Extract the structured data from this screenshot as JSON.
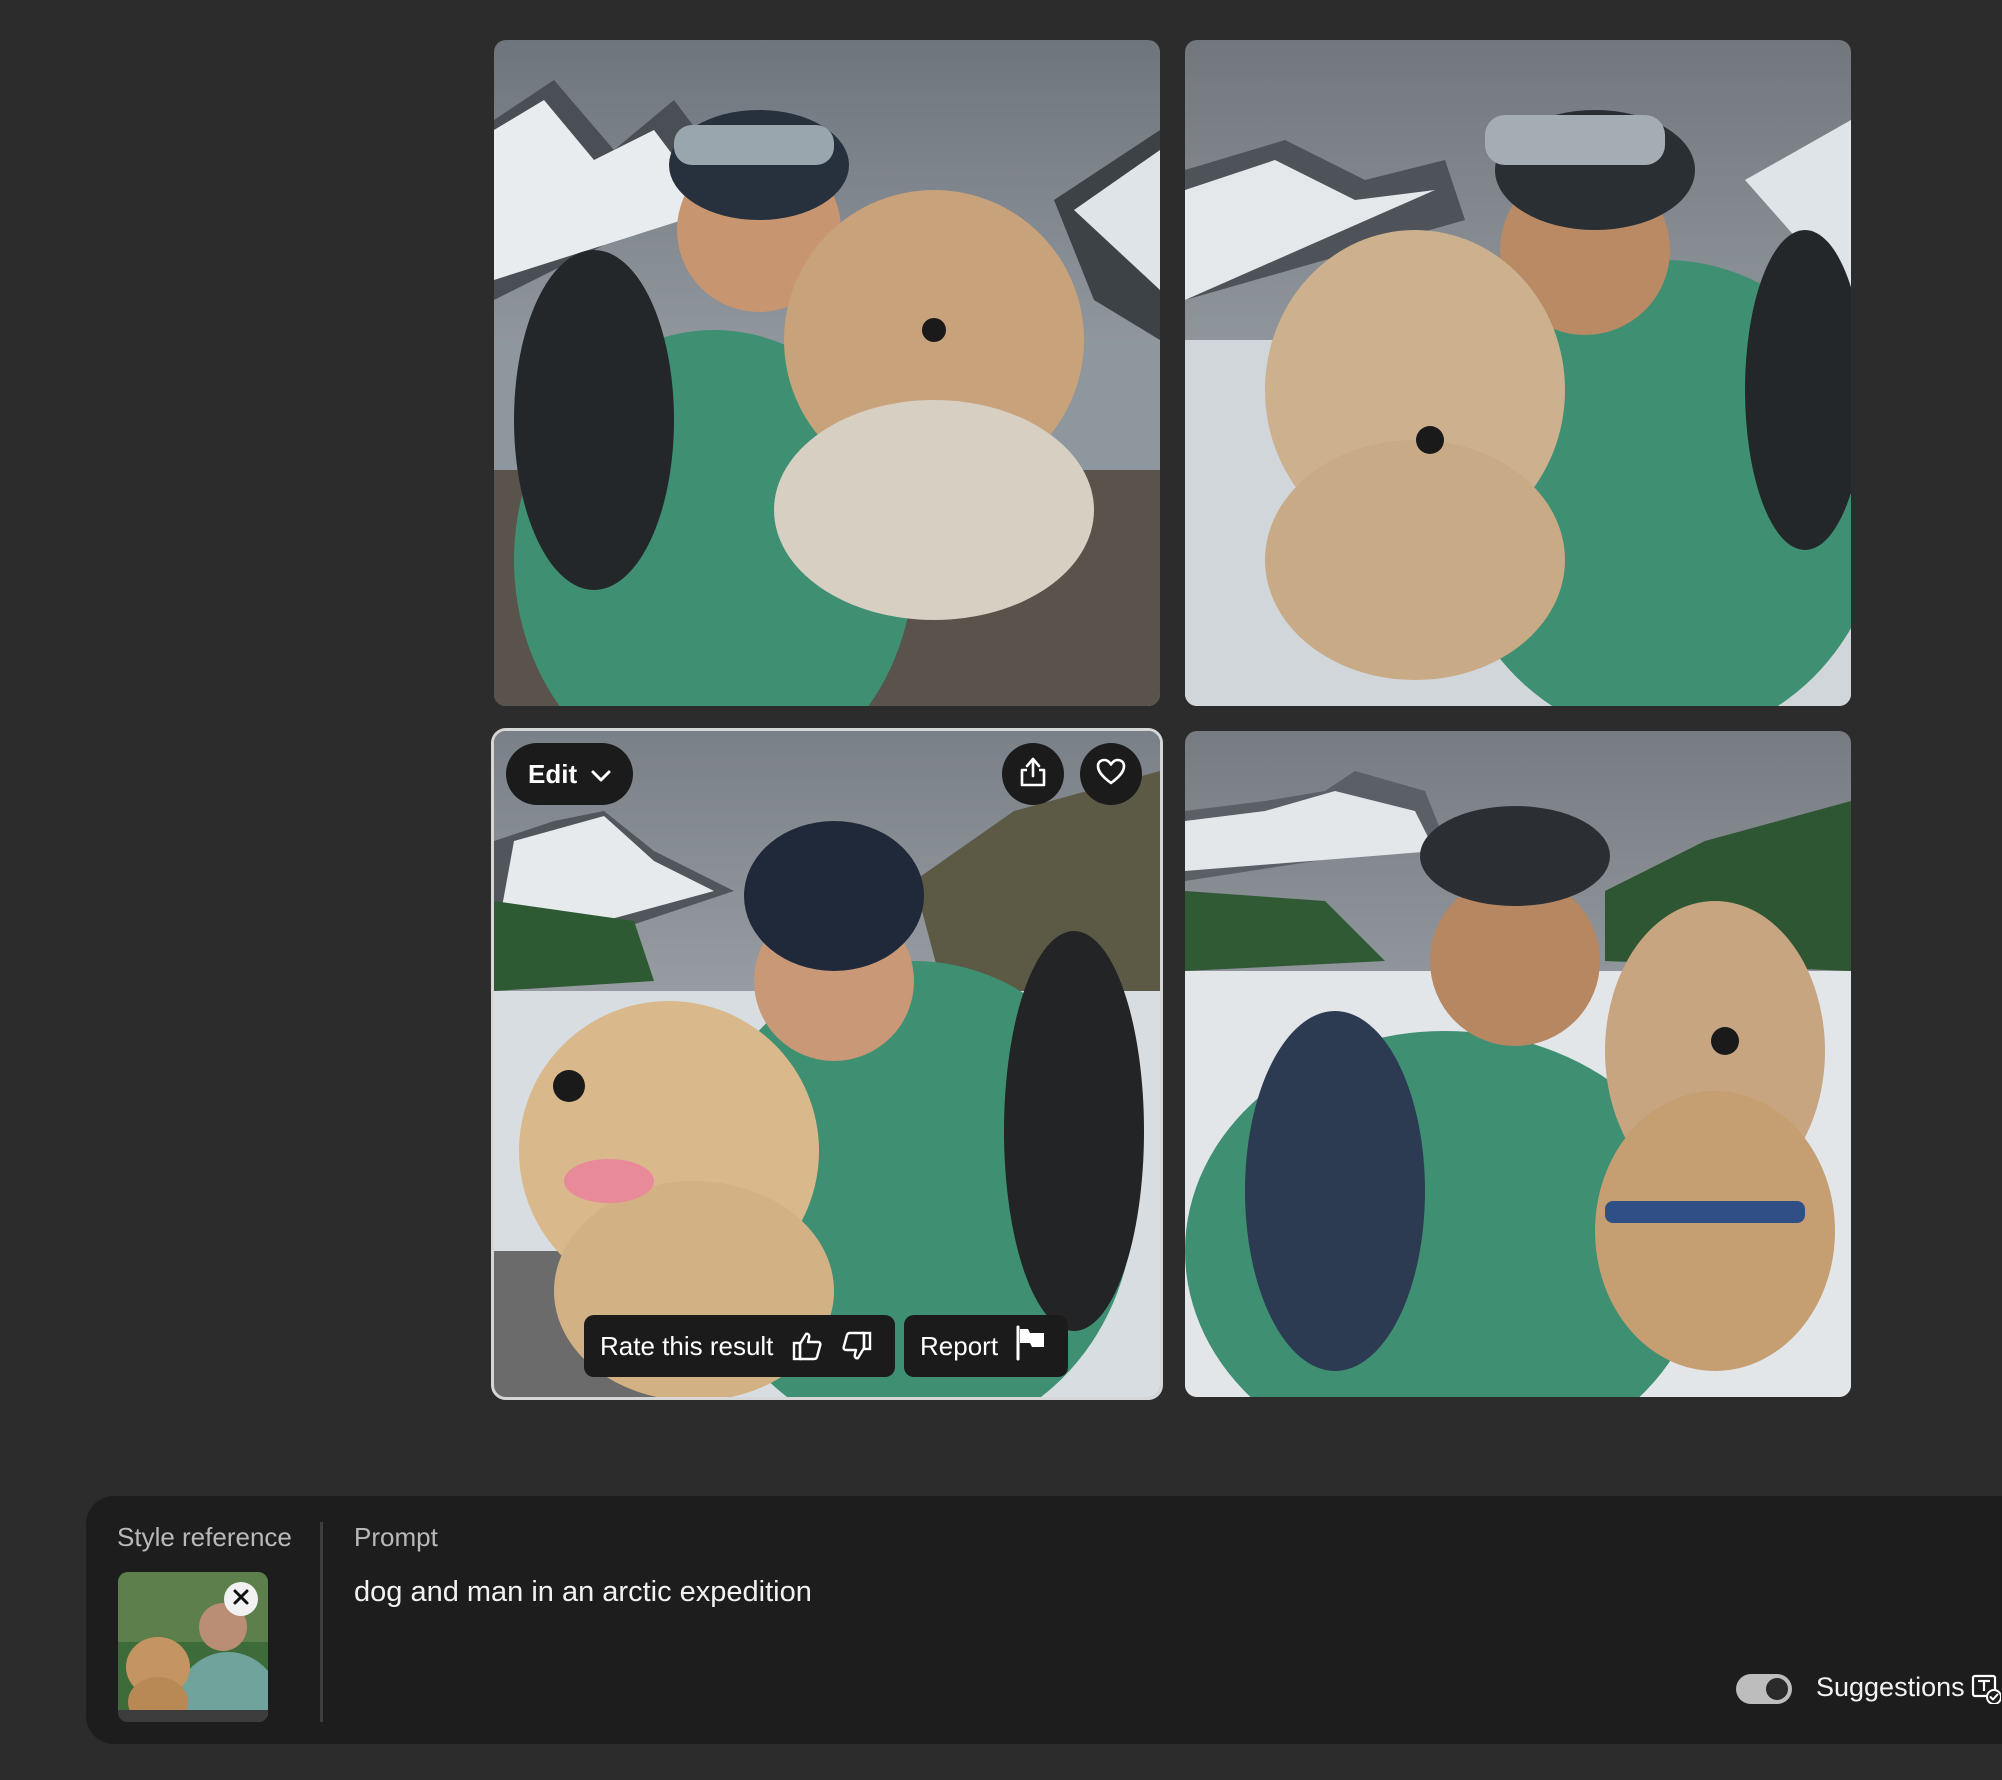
{
  "results": {
    "images": [
      {
        "id": "result-1",
        "description": "man in green jacket with goggles hugging fluffy dog, snowy mountains"
      },
      {
        "id": "result-2",
        "description": "man with goggles hugging tan dog, snowy mountains"
      },
      {
        "id": "result-3",
        "description": "man in beanie hugging golden retriever by glacier lake"
      },
      {
        "id": "result-4",
        "description": "man in cap hugging shepherd dog by lake and mountains"
      }
    ],
    "selected_index": 2,
    "overlay": {
      "edit_label": "Edit",
      "rate_label": "Rate this result",
      "report_label": "Report",
      "share_icon": "share-icon",
      "favorite_icon": "heart-icon",
      "thumbs_up_icon": "thumbs-up-icon",
      "thumbs_down_icon": "thumbs-down-icon",
      "flag_icon": "flag-icon",
      "chevron_icon": "chevron-down-icon"
    }
  },
  "prompt_bar": {
    "style_reference_label": "Style reference",
    "prompt_label": "Prompt",
    "prompt_text": "dog and man in an arctic expedition",
    "suggestions_label": "Suggestions",
    "suggestions_enabled": true
  },
  "colors": {
    "background": "#2c2c2c",
    "panel": "#1d1d1d",
    "pill": "#1b1b1b",
    "jacket_green": "#3f8f73"
  }
}
